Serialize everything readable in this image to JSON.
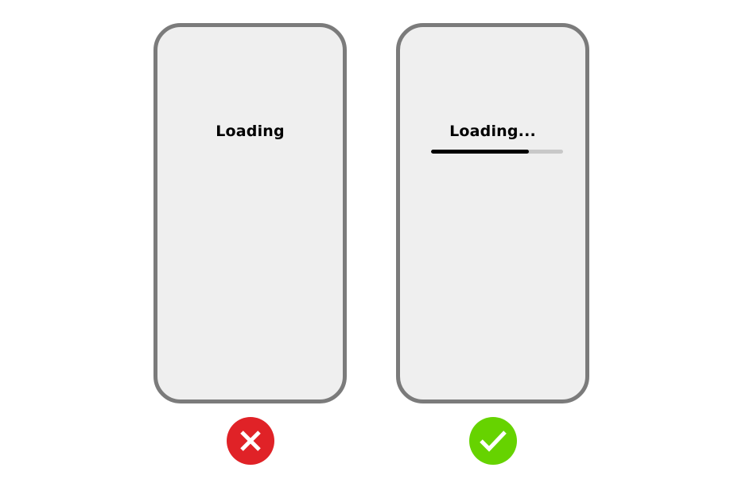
{
  "colors": {
    "background": "#ffffff",
    "phone_fill": "#efefef",
    "phone_border": "#7b7b7b",
    "text": "#000000",
    "progress_fill": "#000000",
    "progress_track": "#c8c8c8",
    "bad_badge": "#e02227",
    "good_badge": "#66d300",
    "badge_symbol": "#ffffff"
  },
  "bad_example": {
    "label": "Loading",
    "icon": "cross-icon"
  },
  "good_example": {
    "label": "Loading...",
    "progress": 0.74,
    "icon": "checkmark-icon"
  }
}
